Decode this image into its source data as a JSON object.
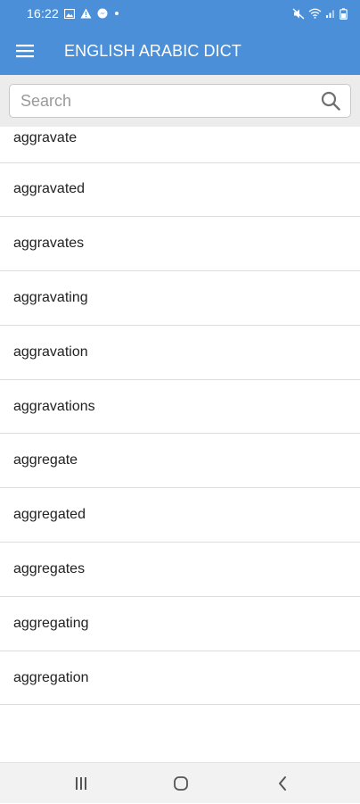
{
  "status_bar": {
    "time": "16:22",
    "icons_left": [
      "image-icon",
      "alert-icon",
      "messenger-icon",
      "dot-icon"
    ],
    "icons_right": [
      "mute-icon",
      "wifi-icon",
      "signal-icon",
      "battery-icon"
    ]
  },
  "app_bar": {
    "title": "ENGLISH ARABIC DICT",
    "menu_icon": "hamburger-menu-icon",
    "color": "#4a8fd8"
  },
  "search": {
    "placeholder": "Search",
    "value": "",
    "icon": "search-icon"
  },
  "words": [
    "aggravate",
    "aggravated",
    "aggravates",
    "aggravating",
    "aggravation",
    "aggravations",
    "aggregate",
    "aggregated",
    "aggregates",
    "aggregating",
    "aggregation"
  ],
  "nav_bar": {
    "buttons": [
      "recent-apps-icon",
      "home-icon",
      "back-icon"
    ]
  }
}
